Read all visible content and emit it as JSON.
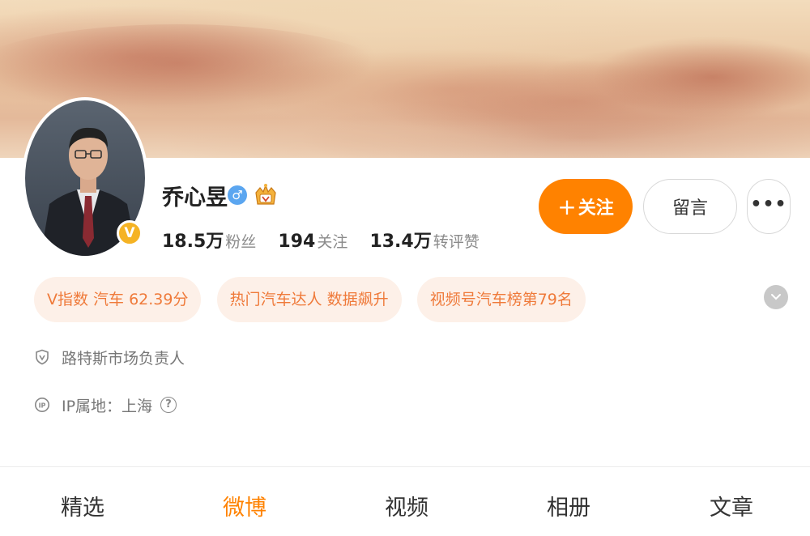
{
  "profile": {
    "name": "乔心昱",
    "gender_symbol": "♂",
    "verified_badge": "V"
  },
  "stats": [
    {
      "num": "18.5万",
      "label": "粉丝"
    },
    {
      "num": "194",
      "label": "关注"
    },
    {
      "num": "13.4万",
      "label": "转评赞"
    }
  ],
  "actions": {
    "follow_plus": "+",
    "follow_label": "关注",
    "message_label": "留言",
    "more_label": "•••"
  },
  "tags": [
    "V指数 汽车 62.39分",
    "热门汽车达人 数据飙升",
    "视频号汽车榜第79名"
  ],
  "info": {
    "verification": "路特斯市场负责人",
    "ip_location": "IP属地：上海",
    "help_symbol": "?"
  },
  "tabs": [
    {
      "label": "精选",
      "active": false
    },
    {
      "label": "微博",
      "active": true
    },
    {
      "label": "视频",
      "active": false
    },
    {
      "label": "相册",
      "active": false
    },
    {
      "label": "文章",
      "active": false
    }
  ],
  "colors": {
    "accent": "#ff8200",
    "tag_bg": "#fdf0e8",
    "tag_text": "#ef7a3a",
    "verified": "#f5b324",
    "gender": "#5ba6f0"
  }
}
